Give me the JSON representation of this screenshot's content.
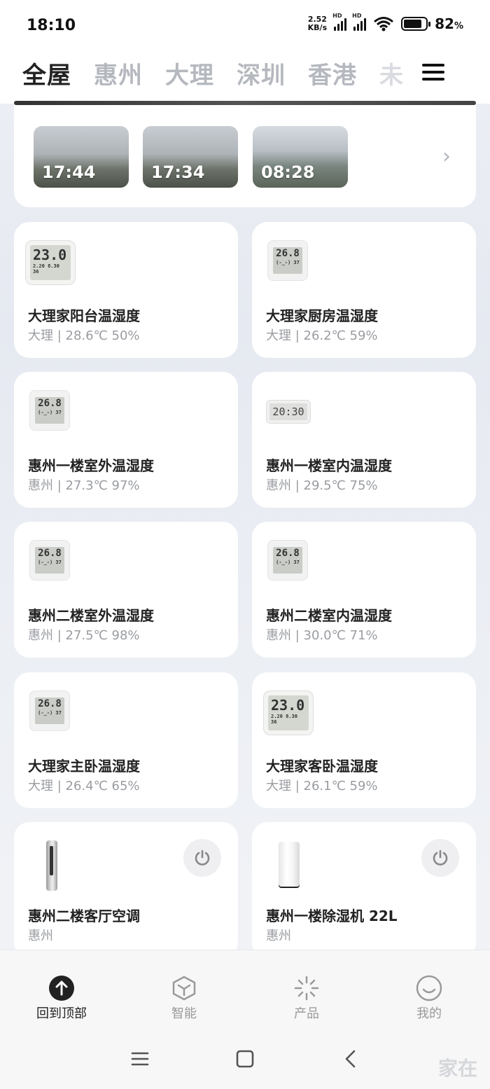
{
  "status_bar": {
    "time": "18:10",
    "net_speed_value": "2.52",
    "net_speed_unit": "KB/s",
    "hd_label": "HD",
    "battery_value": "82",
    "battery_unit": "%",
    "battery_level": 0.82
  },
  "tabs": [
    {
      "label": "全屋",
      "active": true
    },
    {
      "label": "惠州"
    },
    {
      "label": "大理"
    },
    {
      "label": "深圳"
    },
    {
      "label": "香港"
    },
    {
      "label": "未"
    }
  ],
  "cameras": [
    {
      "time": "17:44"
    },
    {
      "time": "17:34"
    },
    {
      "time": "08:28"
    }
  ],
  "devices": [
    {
      "name": "大理家阳台温湿度",
      "sub": "大理 | 28.6℃ 50%",
      "icon": "thermo-hygrometer-large-icon",
      "lcd": "23.0",
      "lcd_small": "2.20  8.30  36"
    },
    {
      "name": "大理家厨房温湿度",
      "sub": "大理 | 26.2℃ 59%",
      "icon": "thermo-hygrometer-square-icon",
      "lcd": "26.8",
      "lcd_small": "(-_-) 37"
    },
    {
      "name": "惠州一楼室外温湿度",
      "sub": "惠州 | 27.3℃ 97%",
      "icon": "thermo-hygrometer-square-icon",
      "lcd": "26.8",
      "lcd_small": "(-_-) 37"
    },
    {
      "name": "惠州一楼室内温湿度",
      "sub": "惠州 | 29.5℃ 75%",
      "icon": "thermo-clock-wide-icon",
      "lcd": "20:30"
    },
    {
      "name": "惠州二楼室外温湿度",
      "sub": "惠州 | 27.5℃ 98%",
      "icon": "thermo-hygrometer-square-icon",
      "lcd": "26.8",
      "lcd_small": "(-_-) 37"
    },
    {
      "name": "惠州二楼室内温湿度",
      "sub": "惠州 | 30.0℃ 71%",
      "icon": "thermo-hygrometer-square-icon",
      "lcd": "26.8",
      "lcd_small": "(-_-) 37"
    },
    {
      "name": "大理家主卧温湿度",
      "sub": "大理 | 26.4℃ 65%",
      "icon": "thermo-hygrometer-square-icon",
      "lcd": "26.8",
      "lcd_small": "(-_-) 37"
    },
    {
      "name": "大理家客卧温湿度",
      "sub": "大理 | 26.1℃ 59%",
      "icon": "thermo-hygrometer-large-icon",
      "lcd": "23.0",
      "lcd_small": "2.20  8.30  36"
    },
    {
      "name": "惠州二楼客厅空调",
      "sub": "惠州",
      "icon": "air-conditioner-icon"
    },
    {
      "name": "惠州一楼除湿机 22L",
      "sub": "惠州",
      "icon": "dehumidifier-icon"
    }
  ],
  "bottom_nav": [
    {
      "label": "回到顶部",
      "icon": "arrow-up-circle-icon",
      "active": true
    },
    {
      "label": "智能",
      "icon": "cube-icon"
    },
    {
      "label": "产品",
      "icon": "sparkle-icon"
    },
    {
      "label": "我的",
      "icon": "smile-icon"
    }
  ],
  "watermark": "家在"
}
